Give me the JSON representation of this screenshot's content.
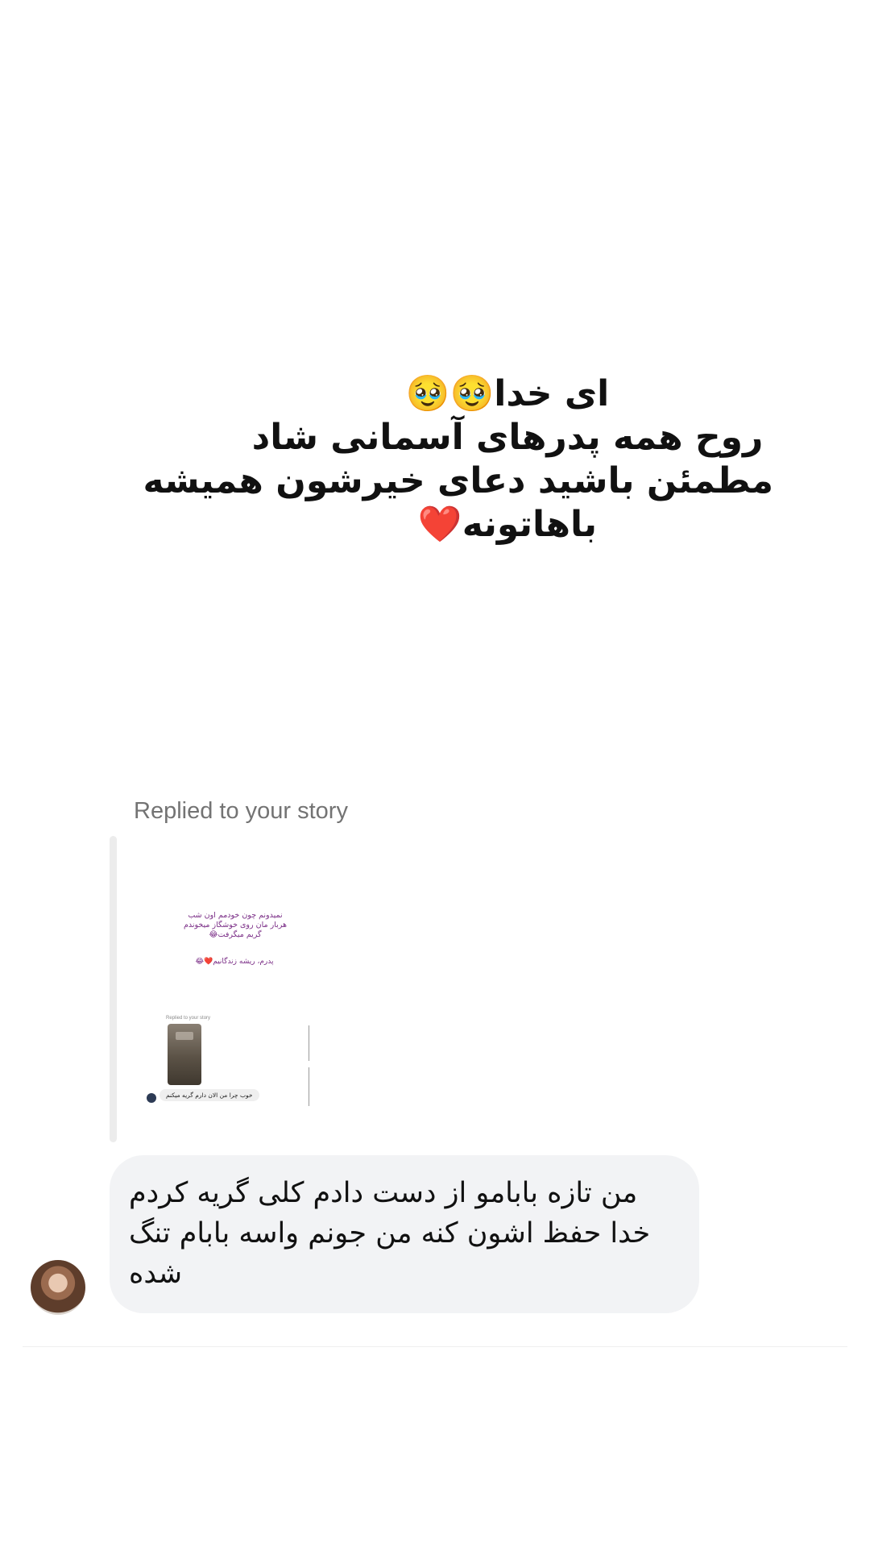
{
  "story_caption": {
    "lines": [
      "ای خدا🥹🥹",
      "روح همه پدرهای آسمانی شاد",
      "مطمئن باشید دعای خیرشون همیشه",
      "باهاتونه❤️"
    ]
  },
  "reply": {
    "label": "Replied to your story",
    "story_preview": {
      "text_main": "نمیدونم چون خودمم اون شب هربار مان روی خوشگاز میخوندم گریم میگرفت😂",
      "text_sub": "پدرم، ریشه زندگانیم❤️😂",
      "inner_reply_label": "Replied to your story",
      "inner_message": "خوب چرا من الان دارم گریه میکنم"
    }
  },
  "message": {
    "lines": [
      "من تازه بابامو از دست دادم کلی گریه کردم",
      "خدا حفظ اشون کنه من جونم واسه بابام تنگ",
      "شده"
    ]
  }
}
